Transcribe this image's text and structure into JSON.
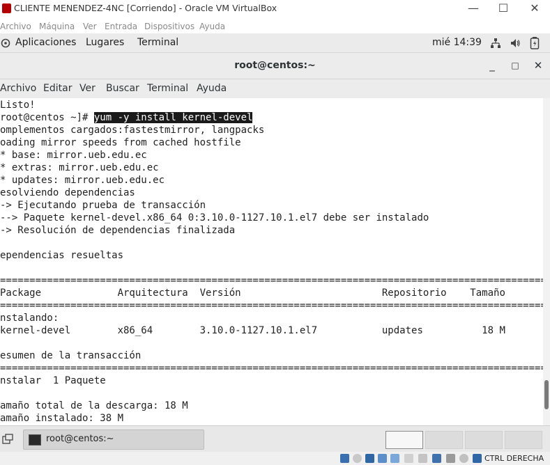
{
  "vbox": {
    "window_title": "CLIENTE MENENDEZ-4NC [Corriendo] - Oracle VM VirtualBox",
    "controls": {
      "minimize": "—",
      "maximize": "☐",
      "close": "✕"
    },
    "menu": [
      "Archivo",
      "Máquina",
      "Ver",
      "Entrada",
      "Dispositivos",
      "Ayuda"
    ],
    "host_key": "CTRL DERECHA",
    "status_icons": [
      "optical-disk-icon",
      "audio-icon",
      "network-icon",
      "usb-icon",
      "shared-folder-icon",
      "display-icon",
      "video-capture-icon",
      "cpu-icon",
      "mouse-integration-icon",
      "arrow-down-icon"
    ]
  },
  "panel": {
    "menu": [
      "Aplicaciones",
      "Lugares",
      "Terminal"
    ],
    "clock": "mié 14:39",
    "tray_icons": [
      "network-icon",
      "volume-icon",
      "battery-icon"
    ]
  },
  "terminal": {
    "title": "root@centos:~",
    "controls": {
      "minimize": "_",
      "maximize": "□",
      "close": "✕"
    },
    "menu": [
      "Archivo",
      "Editar",
      "Ver",
      "Buscar",
      "Terminal",
      "Ayuda"
    ],
    "lines_before": "Listo!\nroot@centos ~]# ",
    "command": "yum -y install kernel-devel",
    "lines_after": "\nomplementos cargados:fastestmirror, langpacks\noading mirror speeds from cached hostfile\n* base: mirror.ueb.edu.ec\n* extras: mirror.ueb.edu.ec\n* updates: mirror.ueb.edu.ec\nesolviendo dependencias\n-> Ejecutando prueba de transacción\n--> Paquete kernel-devel.x86_64 0:3.10.0-1127.10.1.el7 debe ser instalado\n-> Resolución de dependencias finalizada\n\nependencias resueltas\n\n=======================================================================================================\nPackage             Arquitectura  Versión                        Repositorio    Tamaño\n=======================================================================================================\nnstalando:\nkernel-devel        x86_64        3.10.0-1127.10.1.el7           updates          18 M\n\nesumen de la transacción\n=======================================================================================================\nnstalar  1 Paquete\n\namaño total de la descarga: 18 M\namaño instalado: 38 M"
  },
  "taskbar": {
    "task_label": "root@centos:~",
    "workspaces": 4,
    "active_workspace": 1
  },
  "colors": {
    "terminal_bg": "#ffffff",
    "terminal_fg": "#222222",
    "selection_bg": "#1a1a1a",
    "panel_bg": "#ebebeb"
  }
}
